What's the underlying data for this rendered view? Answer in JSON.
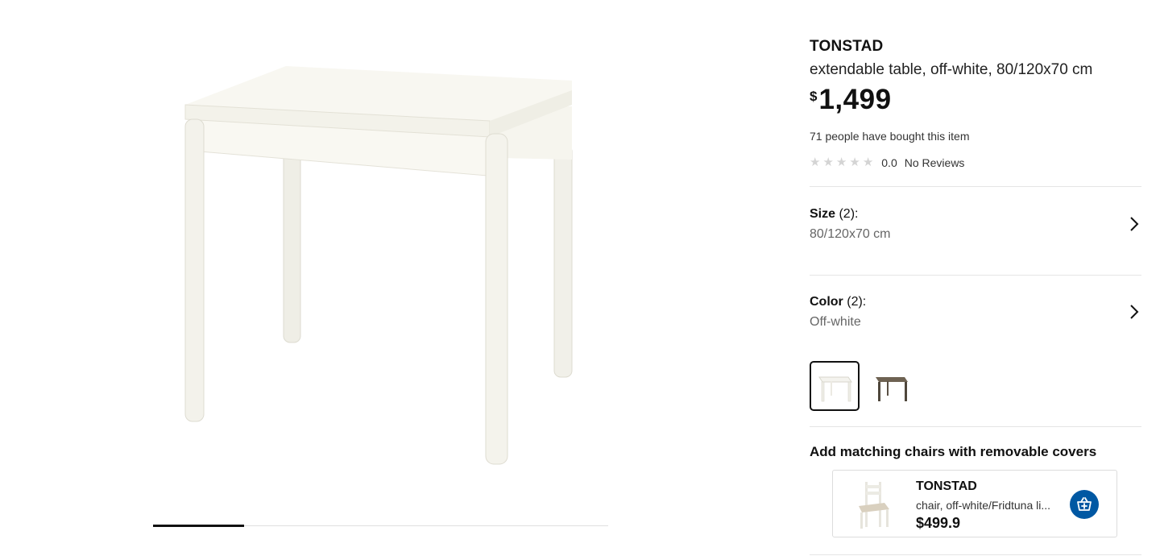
{
  "product": {
    "brand": "TONSTAD",
    "description": "extendable table, off-white, 80/120x70 cm",
    "price_currency": "$",
    "price_amount": "1,499",
    "bought_text": "71 people have bought this item",
    "rating": {
      "score": "0.0",
      "reviews_text": "No Reviews",
      "stars_filled": 0,
      "stars_total": 5
    }
  },
  "gallery": {
    "progress_fraction": 0.2,
    "image_icon": "table-image"
  },
  "options": {
    "size": {
      "label": "Size",
      "count": "(2):",
      "value": "80/120x70 cm"
    },
    "color": {
      "label": "Color",
      "count": "(2):",
      "value": "Off-white"
    }
  },
  "swatches": [
    {
      "name": "Off-white",
      "selected": true,
      "color": "#f2f0ea"
    },
    {
      "name": "brown",
      "selected": false,
      "color": "#6b5d4c"
    }
  ],
  "matching": {
    "title": "Add matching chairs with removable covers",
    "card": {
      "brand": "TONSTAD",
      "description": "chair, off-white/Fridtuna li...",
      "price": "$499.9",
      "cart_icon": "cart-add-icon"
    }
  },
  "colors": {
    "accent": "#0058a3",
    "text": "#111111",
    "muted": "#666666",
    "divider": "#e5e5e5"
  }
}
